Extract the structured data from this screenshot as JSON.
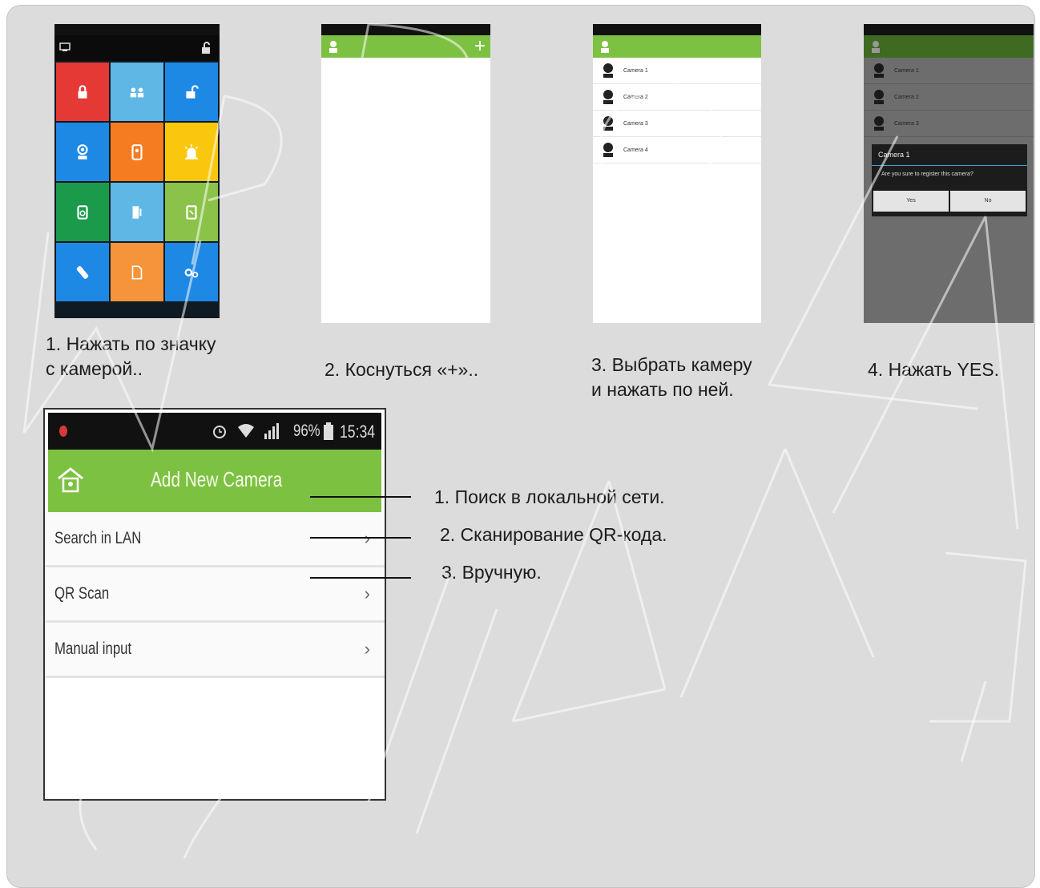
{
  "steps": [
    {
      "caption": "1. Нажать по значку\nс камерой.."
    },
    {
      "caption": "2. Коснуться «+».."
    },
    {
      "caption": "3. Выбрать камеру\nи нажать по ней."
    },
    {
      "caption": "4. Нажать YES."
    }
  ],
  "phone2": {
    "add_icon": "+"
  },
  "phone3": {
    "cameras": [
      "Camera 1",
      "Camera 2",
      "Camera 3",
      "Camera 4"
    ]
  },
  "phone4": {
    "cameras": [
      "Camera 1",
      "Camera 2",
      "Camera 3"
    ],
    "dialog_title": "Camera 1",
    "dialog_message": "Are you sure to register this camera?",
    "yes_label": "Yes",
    "no_label": "No"
  },
  "phone5": {
    "status": {
      "signal": "96%",
      "time": "15:34"
    },
    "title": "Add New Camera",
    "menu": [
      {
        "label": "Search in LAN"
      },
      {
        "label": "QR Scan"
      },
      {
        "label": "Manual input"
      }
    ],
    "chevron": "›"
  },
  "annotations": [
    "1. Поиск в локальной сети.",
    "2. Сканирование QR-кода.",
    "3. Вручную."
  ],
  "colors": {
    "green": "#7dc142",
    "panel": "#dcdcdc"
  }
}
